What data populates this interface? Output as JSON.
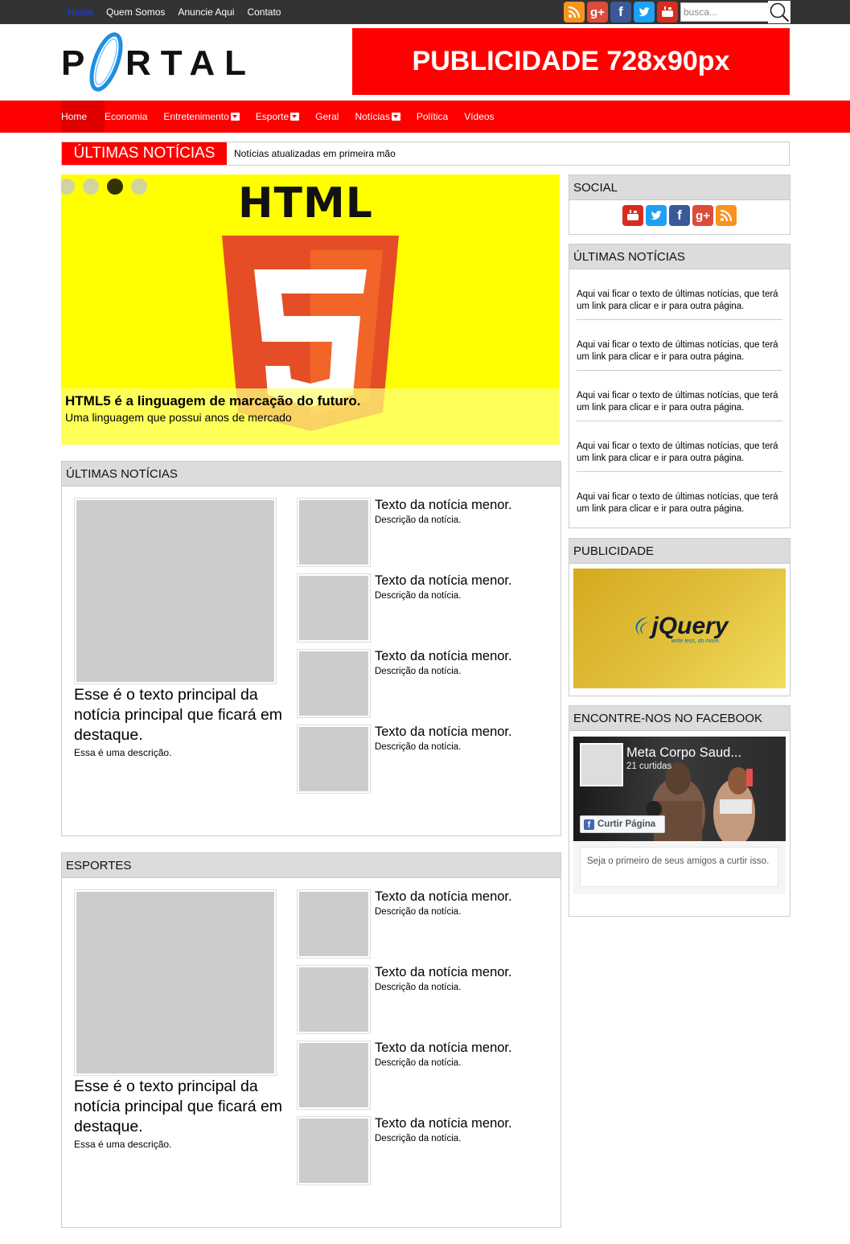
{
  "topbar": {
    "links": [
      "Home",
      "Quem Somos",
      "Anuncie Aqui",
      "Contato"
    ],
    "search_placeholder": "busca..."
  },
  "header": {
    "logo_text": "PORTAL",
    "ad_text": "PUBLICIDADE 728x90px"
  },
  "mainnav": {
    "items": [
      "Home",
      "Economia",
      "Entretenimento",
      "Esporte",
      "Geral",
      "Notícias",
      "Política",
      "Vídeos"
    ]
  },
  "ticker": {
    "label": "ÚLTIMAS NOTÍCIAS",
    "text": "Notícias atualizadas em primeira mão"
  },
  "slider": {
    "heading": "HTML",
    "caption_title": "HTML5 é a linguagem de marcação do futuro.",
    "caption_sub": "Uma linguagem que possui anos de mercado"
  },
  "section_news": {
    "title": "ÚLTIMAS NOTÍCIAS",
    "main_text": "Esse é o texto principal da notícia principal que ficará em destaque.",
    "main_desc": "Essa é uma descrição.",
    "small_title": "Texto da notícia menor.",
    "small_desc": "Descrição da notícia."
  },
  "section_sports": {
    "title": "ESPORTES",
    "main_text": "Esse é o texto principal da notícia principal que ficará em destaque.",
    "main_desc": "Essa é uma descrição.",
    "small_title": "Texto da notícia menor.",
    "small_desc": "Descrição da notícia."
  },
  "sidebar": {
    "social_title": "SOCIAL",
    "news_title": "ÚLTIMAS NOTÍCIAS",
    "news_item": "Aqui vai ficar o texto de últimas notícias, que terá um link para clicar e ir para outra página.",
    "ad_title": "PUBLICIDADE",
    "jquery_text": "jQuery",
    "jquery_tagline": "write less, do more.",
    "facebook_title": "ENCONTRE-NOS NO FACEBOOK",
    "fb_page_name": "Meta Corpo Saud...",
    "fb_likes": "21 curtidas",
    "fb_like_button": "Curtir Página",
    "fb_friends": "Seja o primeiro de seus amigos a curtir isso."
  },
  "colors": {
    "brand_red": "#ff0000",
    "topbar_bg": "#333333",
    "slider_bg": "#ffff00"
  },
  "icons": [
    "rss-icon",
    "google-plus-icon",
    "facebook-icon",
    "twitter-icon",
    "youtube-icon",
    "search-icon",
    "caret-down-icon"
  ]
}
